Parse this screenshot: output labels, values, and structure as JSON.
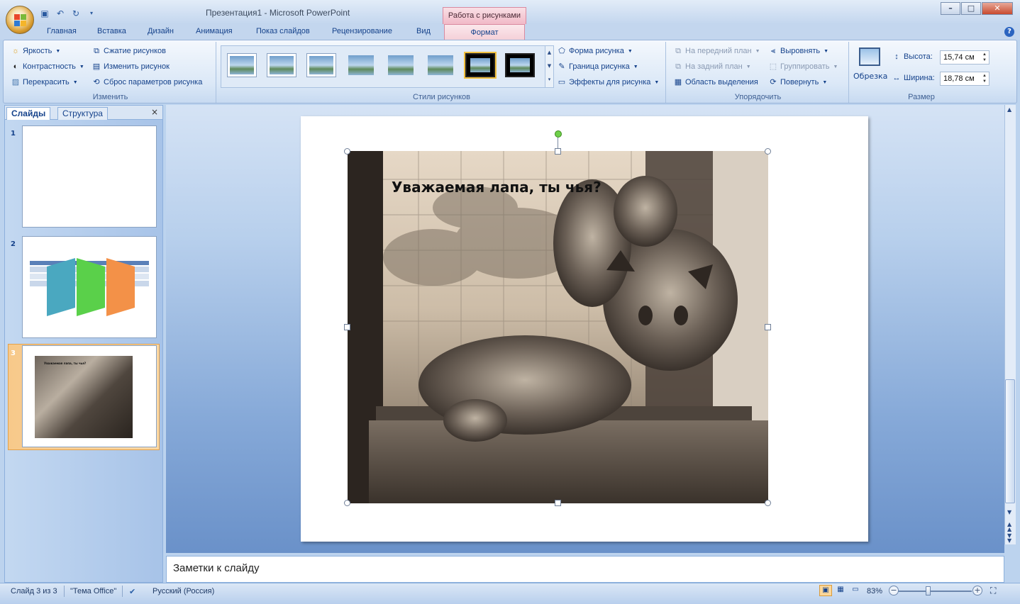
{
  "window": {
    "title": "Презентация1 - Microsoft PowerPoint",
    "context_group": "Работа с рисунками"
  },
  "tabs": [
    "Главная",
    "Вставка",
    "Дизайн",
    "Анимация",
    "Показ слайдов",
    "Рецензирование",
    "Вид",
    "Формат"
  ],
  "ribbon": {
    "adjust": {
      "label": "Изменить",
      "brightness": "Яркость",
      "contrast": "Контрастность",
      "recolor": "Перекрасить",
      "compress": "Сжатие рисунков",
      "change_picture": "Изменить рисунок",
      "reset_picture": "Сброс параметров рисунка"
    },
    "styles": {
      "label": "Стили рисунков",
      "shape": "Форма рисунка",
      "border": "Граница рисунка",
      "effects": "Эффекты для рисунка"
    },
    "arrange": {
      "label": "Упорядочить",
      "bring_front": "На передний план",
      "send_back": "На задний план",
      "selection_pane": "Область выделения",
      "align": "Выровнять",
      "group": "Группировать",
      "rotate": "Повернуть"
    },
    "size": {
      "label": "Размер",
      "crop": "Обрезка",
      "height_label": "Высота:",
      "height_value": "15,74 см",
      "width_label": "Ширина:",
      "width_value": "18,78 см"
    }
  },
  "left_pane": {
    "tab_slides": "Слайды",
    "tab_outline": "Структура",
    "slide_numbers": [
      "1",
      "2",
      "3"
    ],
    "thumb3_caption": "Уважаемая лапа, ты чья?"
  },
  "slide": {
    "caption": "Уважаемая лапа, ты чья?"
  },
  "notes": {
    "placeholder": "Заметки к слайду"
  },
  "status": {
    "slide_info": "Слайд 3 из 3",
    "theme": "\"Тема Office\"",
    "language": "Русский (Россия)",
    "zoom": "83%"
  },
  "colors": {
    "accent_context": "#f1b9c7",
    "selection_orange": "#f7c98a",
    "thumb2_teal": "#4aa8c0",
    "thumb2_green": "#5ad04a",
    "thumb2_orange": "#f39148"
  }
}
